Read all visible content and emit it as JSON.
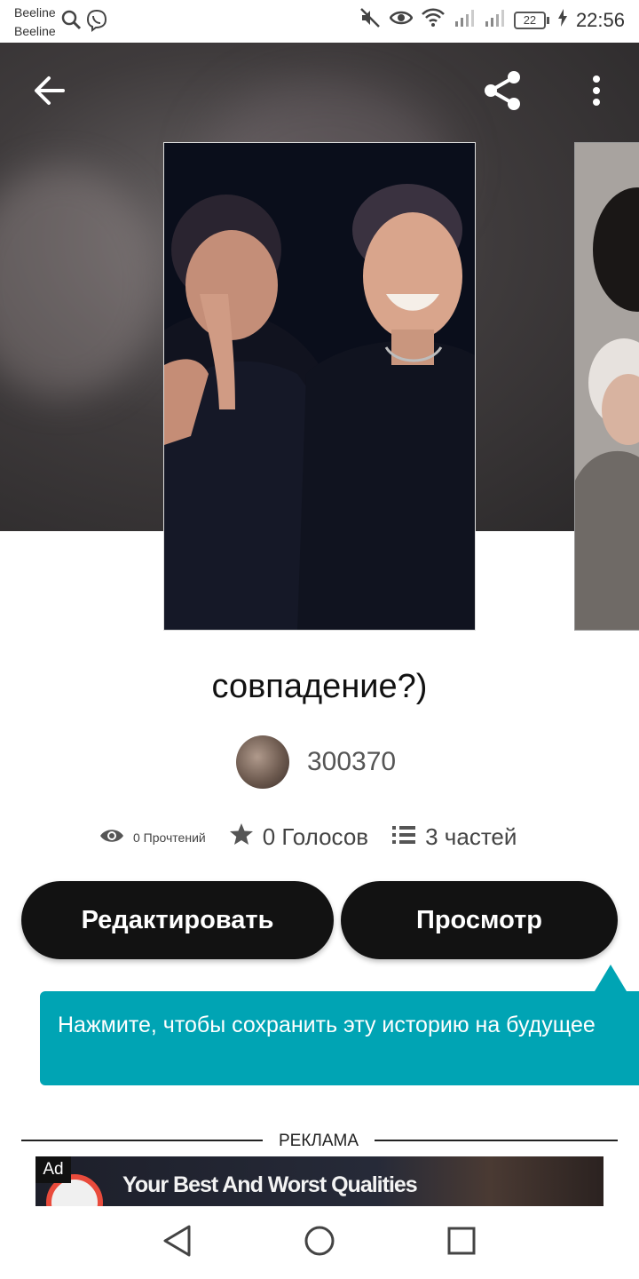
{
  "status_bar": {
    "carrier1": "Beeline",
    "carrier2": "Beeline",
    "battery": "22",
    "time": "22:56",
    "left_icons": [
      "search-icon",
      "viber-icon"
    ],
    "right_icons": [
      "mute-icon",
      "eye-icon",
      "wifi-icon",
      "signal-icon",
      "signal-icon",
      "battery-icon",
      "charging-icon"
    ]
  },
  "header": {
    "icons": [
      "back-arrow-icon",
      "share-icon",
      "more-vertical-icon"
    ]
  },
  "story": {
    "title": "совпадение?)",
    "author": "300370",
    "stats": {
      "reads": "0 Прочтений",
      "votes": "0 Голосов",
      "parts": "3 частей"
    }
  },
  "actions": {
    "edit_label": "Редактировать",
    "view_label": "Просмотр"
  },
  "tooltip": {
    "text": "Нажмите, чтобы сохранить эту историю на будущее"
  },
  "ad": {
    "section_label": "РЕКЛАМА",
    "badge": "Ad",
    "headline": "Your Best And Worst Qualities"
  },
  "nav": {
    "icons": [
      "nav-back-icon",
      "nav-home-icon",
      "nav-recents-icon"
    ]
  },
  "colors": {
    "accent": "#00a4b4",
    "button_bg": "#121212",
    "hero_bg": "#3f3b3c"
  }
}
